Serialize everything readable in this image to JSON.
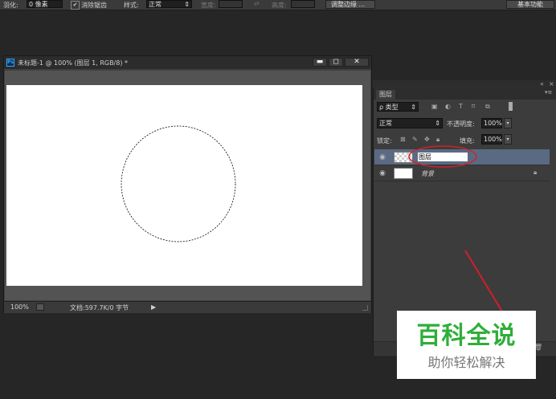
{
  "options_bar": {
    "feather_label": "羽化:",
    "feather_value": "0 像素",
    "antialias_checkbox": "✔",
    "antialias_label": "消除锯齿",
    "style_label": "样式:",
    "style_value": "正常",
    "width_label": "宽度:",
    "swap_glyph": "⇄",
    "height_label": "高度:",
    "refine_edge_button": "调整边缘 ...",
    "workspace_button": "基本功能"
  },
  "document": {
    "ps_badge": "Ps",
    "title": "未标题-1 @ 100% (图层 1, RGB/8) *",
    "zoom": "100%",
    "doc_info": "文档:597.7K/0 字节",
    "status_arrow": "▶"
  },
  "layers_panel": {
    "collapse_glyph": "«",
    "close_glyph": "×",
    "menu_glyph": "▾≡",
    "tab_label": "图层",
    "filter_kind": "ρ 类型",
    "blend_mode": "正常",
    "opacity_label": "不透明度:",
    "opacity_value": "100%",
    "lock_label": "锁定:",
    "fill_label": "填充:",
    "fill_value": "100%",
    "layers": [
      {
        "name": "图层",
        "selected": true,
        "editing": true
      },
      {
        "name": "背景",
        "selected": false,
        "locked": true
      }
    ]
  },
  "watermark": {
    "title": "百科全说",
    "subtitle": "助你轻松解决"
  },
  "colors": {
    "accent_red": "#d21f2a",
    "watermark_green": "#2fae3a",
    "selected_layer_bg": "#5a6a83"
  }
}
